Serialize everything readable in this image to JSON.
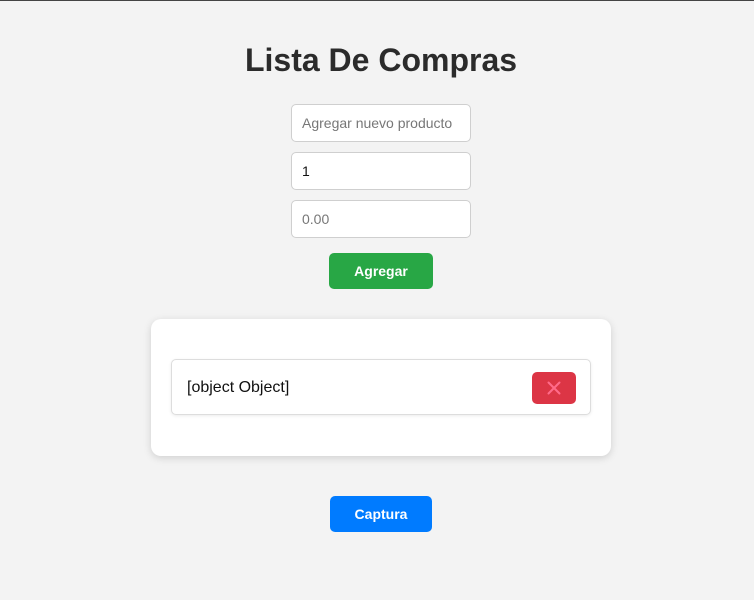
{
  "header": {
    "title": "Lista De Compras"
  },
  "form": {
    "name_placeholder": "Agregar nuevo producto",
    "name_value": "",
    "quantity_value": "1",
    "price_placeholder": "0.00",
    "price_value": "",
    "add_label": "Agregar"
  },
  "list": {
    "items": [
      {
        "text": "[object Object]",
        "delete_icon": "close-icon"
      }
    ]
  },
  "footer": {
    "capture_label": "Captura"
  },
  "colors": {
    "background": "#f3f3f3",
    "add_button": "#28a745",
    "delete_button": "#dc3545",
    "delete_icon": "#ff6b8a",
    "capture_button": "#007bff",
    "title_text": "#2b2b2b"
  }
}
